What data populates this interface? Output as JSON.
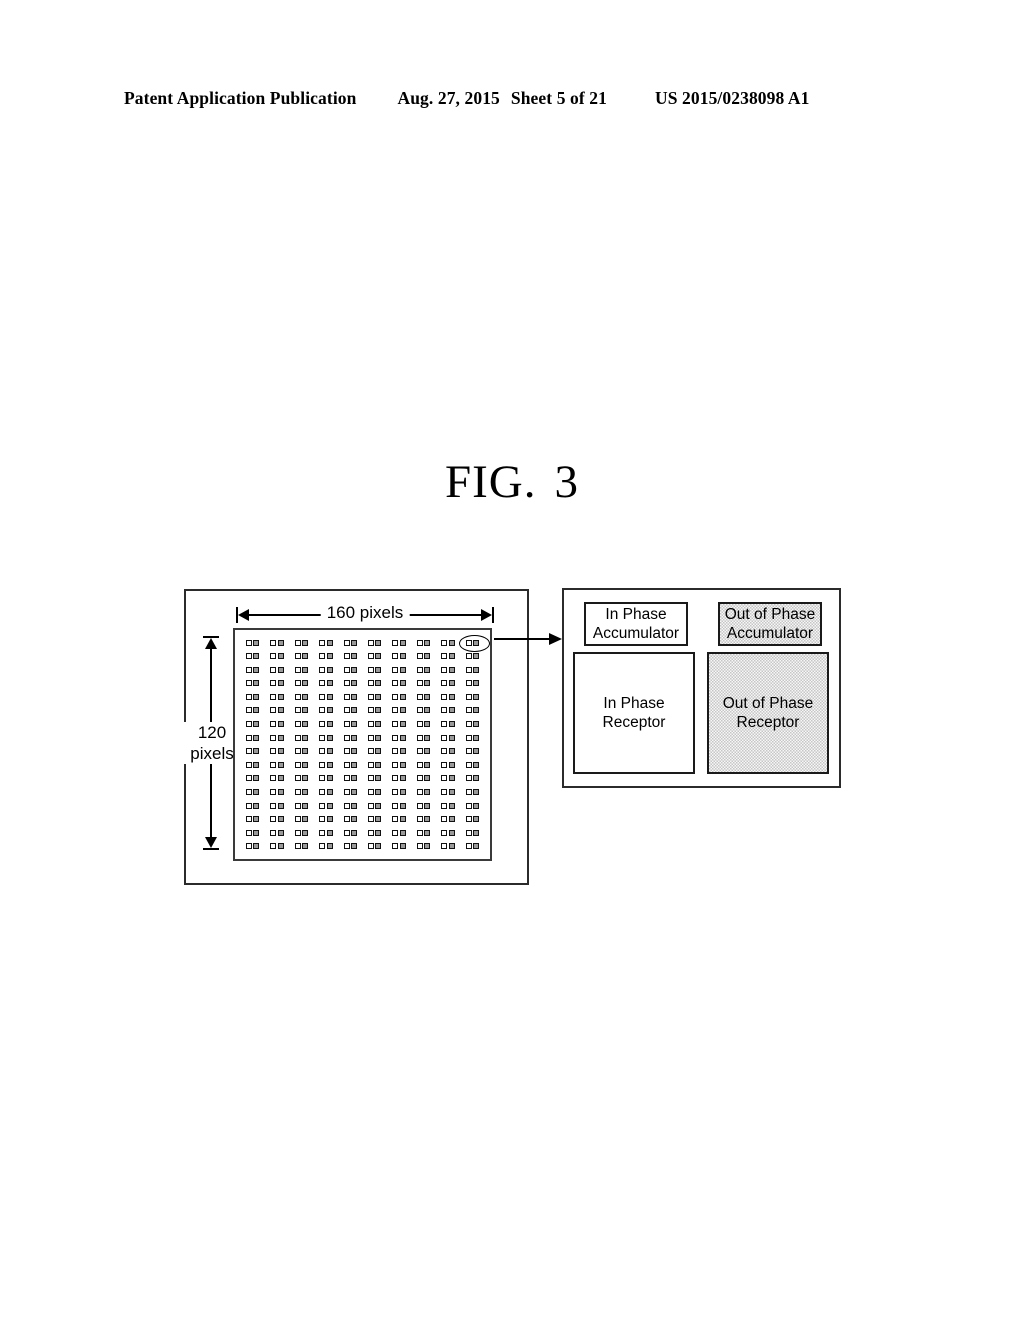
{
  "header": {
    "publication": "Patent Application Publication",
    "date": "Aug. 27, 2015",
    "sheet": "Sheet 5 of 21",
    "document_number": "US 2015/0238098 A1"
  },
  "figure": {
    "label": "FIG.",
    "number": "3"
  },
  "sensor_array": {
    "width_label": "160 pixels",
    "height_label_line1": "120",
    "height_label_line2": "pixels",
    "grid_columns": 10,
    "grid_rows": 16,
    "highlighted_cell": {
      "row": 0,
      "column": 9
    },
    "subpixel_in_phase_color": "#ffffff",
    "subpixel_out_of_phase_color": "#9a9a9a"
  },
  "pixel_block_diagram": {
    "blocks": [
      {
        "id": "in-phase-accumulator",
        "line1": "In Phase",
        "line2": "Accumulator",
        "shaded": false
      },
      {
        "id": "out-of-phase-accumulator",
        "line1": "Out of Phase",
        "line2": "Accumulator",
        "shaded": true
      },
      {
        "id": "in-phase-receptor",
        "line1": "In Phase",
        "line2": "Receptor",
        "shaded": false
      },
      {
        "id": "out-of-phase-receptor",
        "line1": "Out of Phase",
        "line2": "Receptor",
        "shaded": true
      }
    ],
    "shade_color": "#c6c6c6"
  }
}
